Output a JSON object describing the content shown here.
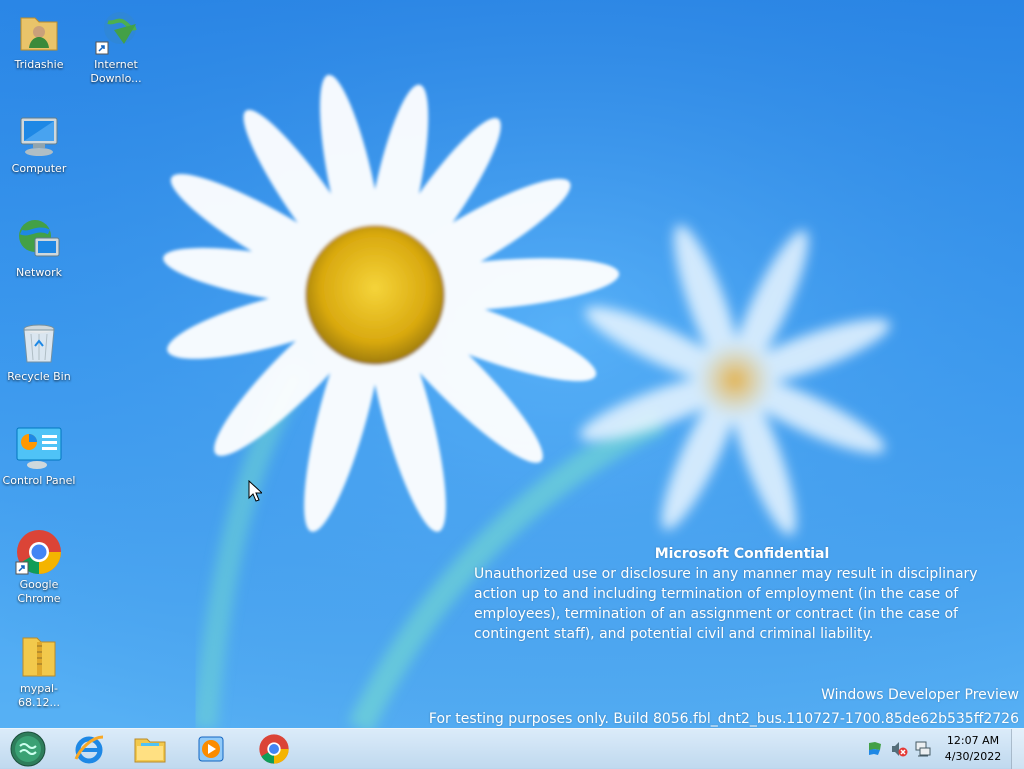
{
  "desktop": {
    "icons": [
      {
        "id": "tridashie",
        "label": "Tridashie",
        "icon": "user-folder-icon"
      },
      {
        "id": "internet-download",
        "label": "Internet Downlo...",
        "icon": "idm-globe-shortcut-icon"
      },
      {
        "id": "computer",
        "label": "Computer",
        "icon": "computer-icon"
      },
      {
        "id": "network",
        "label": "Network",
        "icon": "network-icon"
      },
      {
        "id": "recycle-bin",
        "label": "Recycle Bin",
        "icon": "recycle-bin-icon"
      },
      {
        "id": "control-panel",
        "label": "Control Panel",
        "icon": "control-panel-icon"
      },
      {
        "id": "google-chrome",
        "label": "Google Chrome",
        "icon": "chrome-shortcut-icon"
      },
      {
        "id": "mypal",
        "label": "mypal-68.12...",
        "icon": "zip-folder-icon"
      }
    ]
  },
  "watermark": {
    "title": "Microsoft Confidential",
    "body": "Unauthorized use or disclosure in any manner may result in disciplinary action up to and including termination of employment (in the case of employees), termination of an assignment or contract (in the case of contingent staff), and potential civil and criminal liability.",
    "build_name": "Windows Developer Preview",
    "build_info": "For testing purposes only. Build 8056.fbl_dnt2_bus.110727-1700.85de62b535ff2726"
  },
  "taskbar": {
    "pinned": [
      {
        "id": "start",
        "icon": "start-orb-icon"
      },
      {
        "id": "internet-explorer",
        "icon": "internet-explorer-icon"
      },
      {
        "id": "file-explorer",
        "icon": "file-explorer-icon"
      },
      {
        "id": "media-player",
        "icon": "media-player-icon"
      },
      {
        "id": "chrome",
        "icon": "chrome-icon"
      }
    ],
    "tray": [
      "action-center-flag-icon",
      "volume-muted-icon",
      "network-status-icon"
    ],
    "clock": {
      "time": "12:07 AM",
      "date": "4/30/2022"
    }
  },
  "colors": {
    "accent": "#2a86e6",
    "text": "#ffffff"
  }
}
